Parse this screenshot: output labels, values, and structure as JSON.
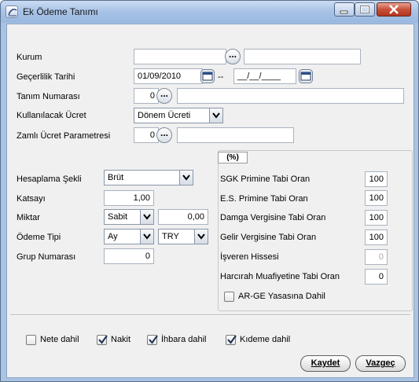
{
  "window": {
    "title": "Ek Ödeme Tanımı"
  },
  "form": {
    "kurum": {
      "label": "Kurum",
      "value": "",
      "name_value": ""
    },
    "gecerlilik": {
      "label": "Geçerlilik Tarihi",
      "start": "01/09/2010",
      "separator": "--",
      "end": "__/__/____"
    },
    "tanim_no": {
      "label": "Tanım Numarası",
      "value": "0",
      "name_value": ""
    },
    "kullanilacak_ucret": {
      "label": "Kullanılacak Ücret",
      "value": "Dönem Ücreti"
    },
    "zamli": {
      "label": "Zamlı Ücret Parametresi",
      "value": "0",
      "name_value": ""
    }
  },
  "ellipsis_text": "...",
  "calc": {
    "hesaplama": {
      "label": "Hesaplama Şekli",
      "value": "Brüt"
    },
    "katsayi": {
      "label": "Katsayı",
      "value": "1,00"
    },
    "miktar": {
      "label": "Miktar",
      "type": "Sabit",
      "value": "0,00"
    },
    "odeme_tipi": {
      "label": "Ödeme Tipi",
      "period": "Ay",
      "currency": "TRY"
    },
    "grup": {
      "label": "Grup Numarası",
      "value": "0"
    }
  },
  "percent": {
    "tab_label": "(%)",
    "rows": [
      {
        "label": "SGK Primine Tabi Oran",
        "value": "100",
        "enabled": true
      },
      {
        "label": "E.S. Primine Tabi Oran",
        "value": "100",
        "enabled": true
      },
      {
        "label": "Damga Vergisine Tabi Oran",
        "value": "100",
        "enabled": true
      },
      {
        "label": "Gelir Vergisine Tabi Oran",
        "value": "100",
        "enabled": true
      },
      {
        "label": "İşveren Hissesi",
        "value": "0",
        "enabled": false
      },
      {
        "label": "Harcırah Muafiyetine Tabi Oran",
        "value": "0",
        "enabled": true
      }
    ],
    "arge": {
      "label": "AR-GE Yasasına Dahil",
      "checked": false
    }
  },
  "options": [
    {
      "label": "Nete dahil",
      "checked": false
    },
    {
      "label": "Nakit",
      "checked": true
    },
    {
      "label": "İhbara dahil",
      "checked": true
    },
    {
      "label": "Kıdeme dahil",
      "checked": true
    }
  ],
  "buttons": {
    "save": "Kaydet",
    "cancel": "Vazgeç"
  }
}
